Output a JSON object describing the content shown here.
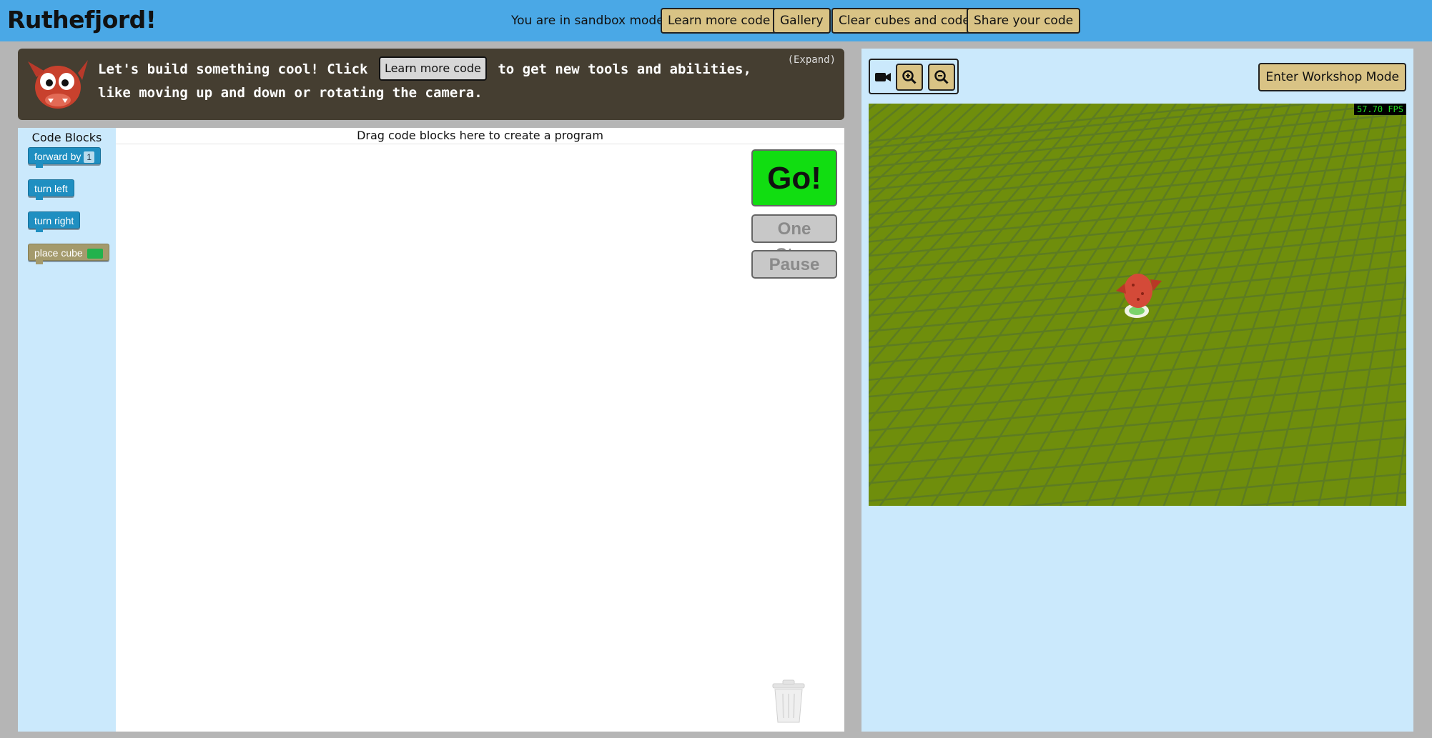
{
  "header": {
    "logo": "Ruthefjord!",
    "mode_text": "You are in sandbox mode!",
    "buttons": [
      "Learn more code",
      "Gallery",
      "Clear cubes and code",
      "Share your code"
    ]
  },
  "banner": {
    "text_before": "Let's build something cool! Click",
    "inline_button": "Learn more code",
    "text_after": "to get new tools and abilities, like moving up and down or rotating the camera.",
    "expand": "(Expand)"
  },
  "toolbox": {
    "title": "Code Blocks",
    "blocks": [
      {
        "label": "forward by",
        "value": "1"
      },
      {
        "label": "turn left"
      },
      {
        "label": "turn right"
      },
      {
        "label": "place cube",
        "swatch_color": "#22b24c"
      }
    ]
  },
  "canvas": {
    "hint": "Drag code blocks here to create a program",
    "go": "Go!",
    "one_step": "One Step",
    "pause": "Pause"
  },
  "viewer": {
    "workshop_button": "Enter Workshop Mode",
    "fps": "57.70 FPS",
    "ground_color": "#6f8e0c"
  },
  "colors": {
    "header_bg": "#4aa8e6",
    "button_tan": "#d9c385",
    "go_green": "#11dd11",
    "banner_bg": "#453e31",
    "panel_blue": "#cbe9fc",
    "block_blue": "#1f8fc1"
  }
}
